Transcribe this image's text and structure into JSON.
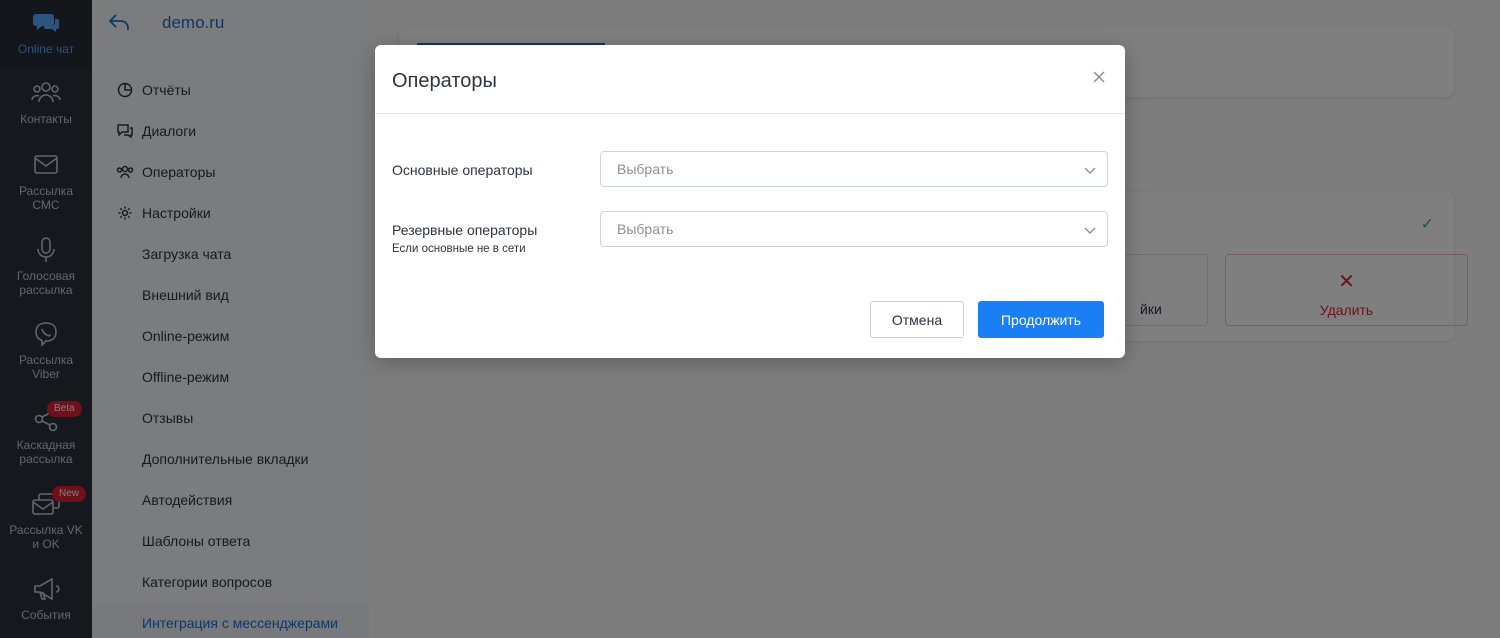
{
  "rail": {
    "items": [
      {
        "label": "Online чат",
        "icon": "chat-bubbles-icon"
      },
      {
        "label": "Контакты",
        "icon": "users-icon"
      },
      {
        "label": "Рассылка СМС",
        "icon": "envelope-icon"
      },
      {
        "label": "Голосовая рассылка",
        "icon": "microphone-icon"
      },
      {
        "label": "Рассылка Viber",
        "icon": "viber-icon"
      },
      {
        "label": "Каскадная рассылка",
        "icon": "share-nodes-icon",
        "badge": "Beta"
      },
      {
        "label": "Рассылка VK и OK",
        "icon": "mail-stack-icon",
        "badge": "New"
      },
      {
        "label": "События",
        "icon": "megaphone-icon"
      }
    ]
  },
  "sidebar": {
    "site": "demo.ru",
    "items": [
      {
        "label": "Отчёты"
      },
      {
        "label": "Диалоги"
      },
      {
        "label": "Операторы"
      },
      {
        "label": "Настройки"
      },
      {
        "label": "Загрузка чата"
      },
      {
        "label": "Внешний вид"
      },
      {
        "label": "Online-режим"
      },
      {
        "label": "Offline-режим"
      },
      {
        "label": "Отзывы"
      },
      {
        "label": "Дополнительные вкладки"
      },
      {
        "label": "Автодействия"
      },
      {
        "label": "Шаблоны ответа"
      },
      {
        "label": "Категории вопросов"
      },
      {
        "label": "Интеграция с мессенджерами"
      }
    ]
  },
  "background": {
    "settings_fragment": "йки",
    "delete_label": "Удалить"
  },
  "modal": {
    "title": "Операторы",
    "primary": {
      "label": "Основные операторы",
      "placeholder": "Выбрать"
    },
    "backup": {
      "label": "Резервные операторы",
      "hint": "Если основные не в сети",
      "placeholder": "Выбрать"
    },
    "cancel_label": "Отмена",
    "continue_label": "Продолжить"
  },
  "colors": {
    "accent": "#1a7ef5",
    "link": "#1a6fd6",
    "danger": "#e0213a",
    "rail": "#2b323d"
  }
}
